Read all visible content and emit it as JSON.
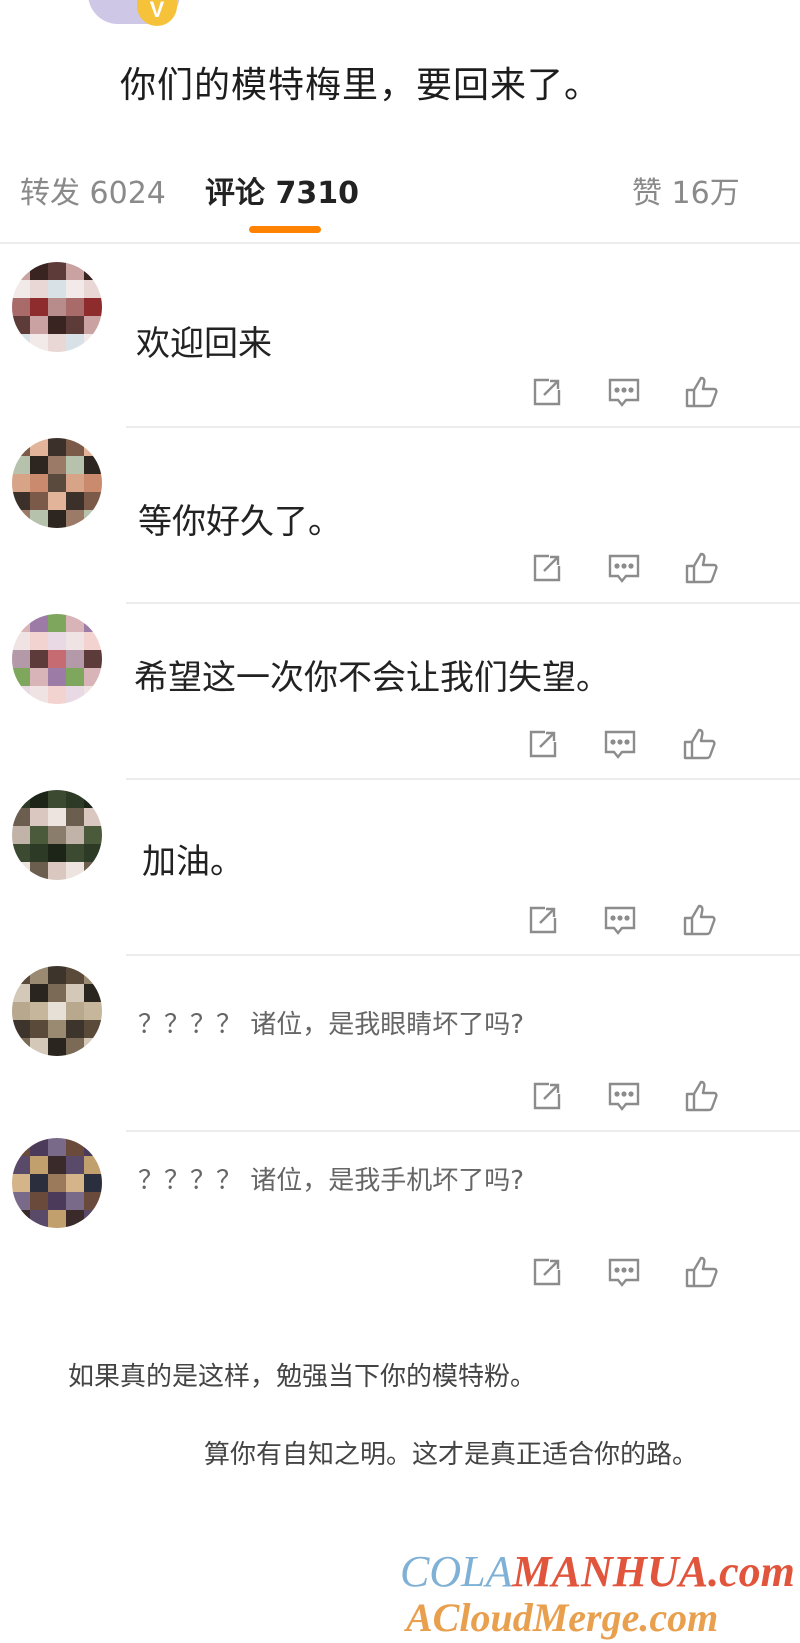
{
  "post": {
    "text": "你们的模特梅里，要回来了。",
    "badge": "V"
  },
  "tabs": {
    "repost": "转发 6024",
    "comments": "评论 7310",
    "likes": "赞 16万"
  },
  "comments": [
    {
      "text": "欢迎回来",
      "avatar_colors": [
        "#c9a2a1",
        "#8e2b2d",
        "#e8d7d4",
        "#3a2422",
        "#b88c8a",
        "#d7e1e6",
        "#5d3b38",
        "#a86b6a",
        "#f2eae8"
      ]
    },
    {
      "text": "等你好久了。",
      "avatar_colors": [
        "#7b5a49",
        "#c98a6d",
        "#2d2520",
        "#e2b49a",
        "#5a4a3d",
        "#9b7b67",
        "#3b302a",
        "#d7a487",
        "#b7c2ad"
      ]
    },
    {
      "text": "希望这一次你不会让我们失望。",
      "avatar_colors": [
        "#d8b4b8",
        "#5c3b3a",
        "#f2d3cf",
        "#9c7ba6",
        "#c76b73",
        "#e9d9e5",
        "#7ea65c",
        "#b49aa8",
        "#efe3e3"
      ]
    },
    {
      "text": "加油。",
      "avatar_colors": [
        "#2d3a25",
        "#4a5a3b",
        "#d9c7c0",
        "#1d2418",
        "#8a7d6b",
        "#eee4df",
        "#3b4a30",
        "#c2b3a9",
        "#6b5e4e"
      ]
    },
    {
      "text": "？？？？ 诸位，是我眼睛坏了吗?",
      "avatar_colors": [
        "#5a4a3a",
        "#c6b79c",
        "#2b2520",
        "#9a8a72",
        "#e6e0d6",
        "#7a6a56",
        "#3d342c",
        "#b8a88e",
        "#d4c9b8"
      ]
    },
    {
      "text": "？？？？ 诸位，是我手机坏了吗?",
      "avatar_colors": [
        "#6a4a3a",
        "#2b2e3c",
        "#c2a06e",
        "#4b3a5a",
        "#9a7a5a",
        "#3a2a2a",
        "#7a6a8a",
        "#d6b48a",
        "#5a4a6a"
      ]
    }
  ],
  "actions": {
    "share": "share-icon",
    "comment": "comment-icon",
    "like": "thumbs-up-icon"
  },
  "bottom": {
    "line1": "如果真的是这样，勉强当下你的模特粉。",
    "line2": "算你有自知之明。这才是真正适合你的路。"
  },
  "watermark": {
    "part1": "COLA",
    "part2": "MANHUA.com",
    "line2": "ACloudMerge.com"
  }
}
